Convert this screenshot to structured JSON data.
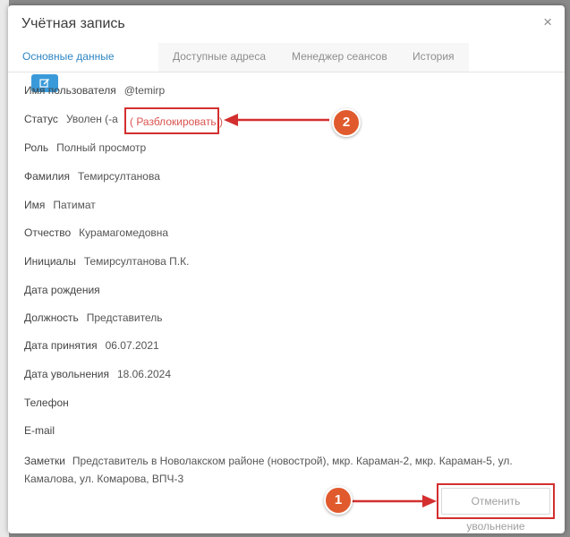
{
  "modal": {
    "title": "Учётная запись",
    "close": "×"
  },
  "tabs": [
    {
      "label": "Основные данные",
      "active": true
    },
    {
      "label": "Доступные адреса",
      "active": false
    },
    {
      "label": "Менеджер сеансов",
      "active": false
    },
    {
      "label": "История",
      "active": false
    }
  ],
  "fields": {
    "username": {
      "label": "Имя пользователя",
      "value": "@temirp"
    },
    "status": {
      "label": "Статус",
      "value": "Уволен (-а",
      "action": "( Разблокировать )"
    },
    "role": {
      "label": "Роль",
      "value": "Полный просмотр"
    },
    "surname": {
      "label": "Фамилия",
      "value": "Темирсултанова"
    },
    "name": {
      "label": "Имя",
      "value": "Патимат"
    },
    "patronymic": {
      "label": "Отчество",
      "value": "Курамагомедовна"
    },
    "initials": {
      "label": "Инициалы",
      "value": "Темирсултанова П.К."
    },
    "birthdate": {
      "label": "Дата рождения",
      "value": ""
    },
    "position": {
      "label": "Должность",
      "value": "Представитель"
    },
    "hire_date": {
      "label": "Дата принятия",
      "value": "06.07.2021"
    },
    "dismissal_date": {
      "label": "Дата увольнения",
      "value": "18.06.2024"
    },
    "phone": {
      "label": "Телефон",
      "value": ""
    },
    "email": {
      "label": "E-mail",
      "value": ""
    },
    "notes": {
      "label": "Заметки",
      "value": "Представитель в Новолакском районе (новострой), мкр. Караман-2, мкр. Караман-5, ул. Камалова, ул. Комарова, ВПЧ-3"
    }
  },
  "footer": {
    "cancel_dismissal": "Отменить увольнение"
  },
  "annotations": {
    "badge_1": "1",
    "badge_2": "2",
    "color": "#d32f2f",
    "badge_color": "#e05a2d"
  },
  "colors": {
    "accent": "#2f86c4",
    "edit_button": "#3a9ad9",
    "unblock_link": "#d9534f"
  }
}
